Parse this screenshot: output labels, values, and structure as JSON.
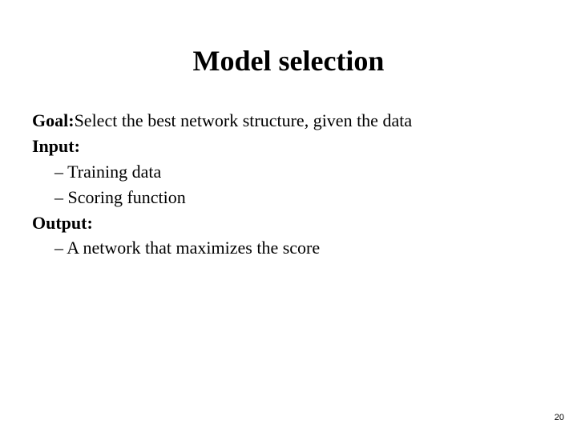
{
  "title": "Model selection",
  "goal": {
    "label": "Goal:",
    "text": " Select the best network structure, given the data"
  },
  "input": {
    "label": "Input:",
    "items": [
      "– Training data",
      "– Scoring function"
    ]
  },
  "output": {
    "label": "Output:",
    "items": [
      "– A network that maximizes the score"
    ]
  },
  "page_number": "20"
}
